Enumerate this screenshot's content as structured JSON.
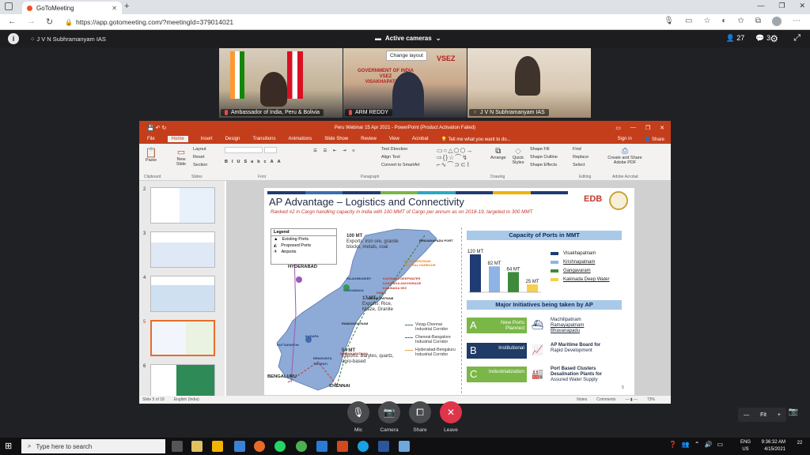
{
  "browser": {
    "tab_title": "GoToMeeting",
    "url": "https://app.gotomeeting.com/?meetingId=379014021"
  },
  "meeting": {
    "presenter_name": "J V N Subhramanyam IAS",
    "camera_label": "Active cameras",
    "attendee_count": "27",
    "chat_count": "3",
    "tooltip": "Change layout",
    "participants": [
      {
        "name": "Ambassador of India, Peru & Bolivia"
      },
      {
        "name": "ARM REDDY"
      },
      {
        "name": "J V N Subhramanyam IAS"
      }
    ],
    "controls": {
      "mic": "Mic",
      "camera": "Camera",
      "share": "Share",
      "leave": "Leave"
    },
    "zoom": {
      "minus": "—",
      "fit": "Fit",
      "plus": "+"
    }
  },
  "ppt": {
    "title": "Peru Webinar 15 Apr 2021 - PowerPoint (Product Activation Failed)",
    "tabs": [
      "File",
      "Home",
      "Insert",
      "Design",
      "Transitions",
      "Animations",
      "Slide Show",
      "Review",
      "View",
      "Acrobat"
    ],
    "tellme": "Tell me what you want to do...",
    "signin": "Sign in",
    "share": "Share",
    "ribbon_groups": [
      "Clipboard",
      "Slides",
      "Font",
      "Paragraph",
      "Drawing",
      "Editing",
      "Adobe Acrobat"
    ],
    "ribbon_buttons": {
      "paste": "Paste",
      "new_slide": "New Slide",
      "layout": "Layout",
      "reset": "Reset",
      "section": "Section",
      "text_direction": "Text Direction",
      "align_text": "Align Text",
      "convert_smartart": "Convert to SmartArt",
      "arrange": "Arrange",
      "quick_styles": "Quick Styles",
      "shape_fill": "Shape Fill",
      "shape_outline": "Shape Outline",
      "shape_effects": "Shape Effects",
      "find": "Find",
      "replace": "Replace",
      "select": "Select",
      "create_pdf": "Create and Share Adobe PDF"
    },
    "thumb_numbers": [
      "2",
      "3",
      "4",
      "5",
      "6"
    ],
    "status": {
      "slide": "Slide 5 of 18",
      "language": "English (India)",
      "notes": "Notes",
      "comments": "Comments",
      "zoom": "73%"
    }
  },
  "slide": {
    "title": "AP Advantage – Logistics and Connectivity",
    "subtitle": "Ranked #2 in Cargo handling capacity in India with 100 MMT of Cargo per annum as on 2018-19, targeted to 300 MMT",
    "edb_logo": "EDB",
    "legend": {
      "header": "Legend",
      "items": [
        "Existing Ports",
        "Proposed Ports",
        "Airports"
      ]
    },
    "map_labels": {
      "hyderabad": "HYDERABAD",
      "bengaluru": "BENGALURU",
      "chennai": "CHENNAI",
      "bhavanapadu": "BHAVANAPADU PORT",
      "vizag_natural": "VISAKHAPATNAM NATURAL HARBOUR",
      "kakinada_deep": "KAKINADA DEEPWATER",
      "kakinada_anch": "KAKINADA ANCHORAGE",
      "kakinada_sez": "KAKINADA SEZ",
      "rawa": "RAWA",
      "machilipatnam": "MACHILIPATNAM",
      "ramayapatnam": "RAMAYAPATNAM",
      "krishnapatnam": "KRISHNAPATNAM",
      "rajahmundry": "RAJAHMUNDRY",
      "vijayawada": "VIJAYAWADA",
      "kadapa": "KADAPA",
      "puttaparthi": "PUTTAPARTHI",
      "renigunta": "RENIGUNTA",
      "tirupati": "TIRUPATI"
    },
    "exports": {
      "north_amt": "100 MT",
      "north_desc": "Exports: iron ore, granite blocks, metals, coal",
      "mid_amt": "17 MT",
      "mid_desc": "Exports: Rice, Maize, Granite",
      "south_amt": "54 MT",
      "south_desc": "Exports: Barytes, quartz, agro-based"
    },
    "corridors": [
      "Vizag-Chennai Industrial Corridor",
      "Chennai-Bangalore Industrial Corridor",
      "Hyderabad-Bengaluru Industrial Corridor"
    ],
    "capacity_header": "Capacity of Ports in MMT",
    "initiatives_header": "Major Initiatives being taken by AP",
    "initiatives": [
      {
        "letter": "A",
        "label": "New Ports Planned",
        "desc": [
          "Machilipatnam",
          "Ramayapatnam",
          "Bhavanapadu"
        ],
        "color": "#7ab648"
      },
      {
        "letter": "B",
        "label": "Institutional",
        "desc": [
          "AP Maritime Board for",
          "Rapid Development"
        ],
        "color": "#1f3b66"
      },
      {
        "letter": "C",
        "label": "Industrialization",
        "desc": [
          "Port Based Clusters",
          "Desalination Plants for",
          "Assured Water Supply"
        ],
        "color": "#7ab648"
      }
    ],
    "page_number": "5"
  },
  "chart_data": {
    "type": "bar",
    "title": "Capacity of Ports in MMT",
    "categories": [
      "Visakhapatnam",
      "Krishnapatnam",
      "Gangavaram",
      "Kakinada Deep Water"
    ],
    "values": [
      120,
      82,
      64,
      25
    ],
    "value_labels": [
      "120 MT",
      "82 MT",
      "64 MT",
      "25 MT"
    ],
    "colors": [
      "#1f3b73",
      "#8eb4e3",
      "#3d8a3d",
      "#f6d04d"
    ],
    "ylim": [
      0,
      130
    ],
    "legend": "right"
  },
  "taskbar": {
    "search_placeholder": "Type here to search",
    "time": "9:36:32 AM",
    "date": "4/15/2021",
    "lang1": "ENG",
    "lang2": "US",
    "notif_count": "22"
  }
}
